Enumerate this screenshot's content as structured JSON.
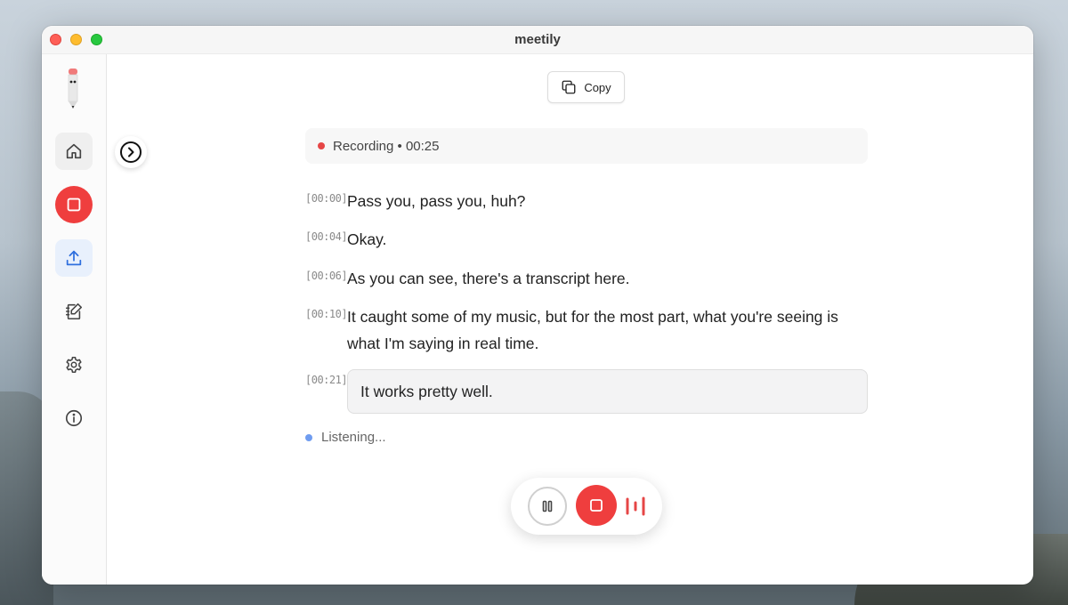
{
  "app": {
    "title": "meetily"
  },
  "colors": {
    "record_red": "#ef3e3e",
    "listening_blue": "#6f9cf0",
    "upload_active_bg": "#e8f0fc"
  },
  "sidebar": {
    "items": [
      {
        "name": "home",
        "icon": "home-icon"
      },
      {
        "name": "record",
        "icon": "stop-square-icon"
      },
      {
        "name": "upload",
        "icon": "upload-icon"
      },
      {
        "name": "notes",
        "icon": "notebook-edit-icon"
      },
      {
        "name": "settings",
        "icon": "gear-icon"
      },
      {
        "name": "info",
        "icon": "info-icon"
      }
    ]
  },
  "toolbar": {
    "copy_label": "Copy"
  },
  "status": {
    "label": "Recording • 00:25"
  },
  "transcript": [
    {
      "time": "[00:00]",
      "text": "Pass you, pass you, huh?"
    },
    {
      "time": "[00:04]",
      "text": "Okay."
    },
    {
      "time": "[00:06]",
      "text": "As you can see, there's a transcript here."
    },
    {
      "time": "[00:10]",
      "text": "It caught some of my music, but for the most part, what you're seeing is what I'm saying in real time."
    },
    {
      "time": "[00:21]",
      "text": "It works pretty well."
    }
  ],
  "listening": {
    "label": "Listening..."
  }
}
